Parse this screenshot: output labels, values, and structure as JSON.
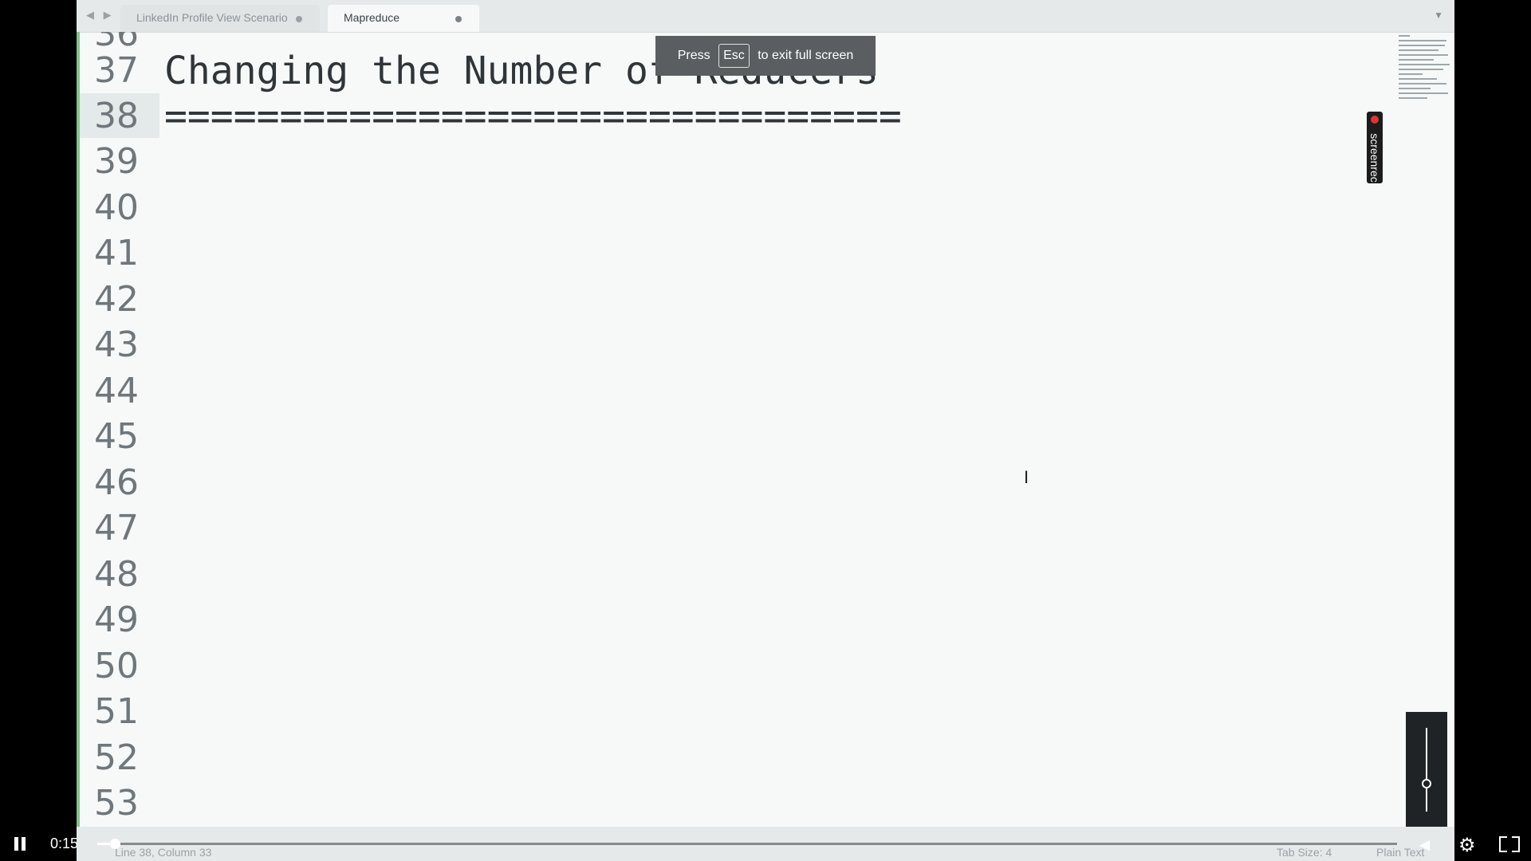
{
  "tabs": [
    {
      "label": "LinkedIn Profile View Scenario",
      "active": false
    },
    {
      "label": "Mapreduce",
      "active": true
    }
  ],
  "tab_nav_arrows": "◀ ▶",
  "tab_menu_icon": "▼",
  "editor": {
    "lines": [
      {
        "num": "37",
        "text": "Changing the Number of Reducers"
      },
      {
        "num": "38",
        "text": "================================"
      },
      {
        "num": "39",
        "text": ""
      },
      {
        "num": "40",
        "text": ""
      },
      {
        "num": "41",
        "text": ""
      },
      {
        "num": "42",
        "text": ""
      },
      {
        "num": "43",
        "text": ""
      },
      {
        "num": "44",
        "text": ""
      },
      {
        "num": "45",
        "text": ""
      },
      {
        "num": "46",
        "text": ""
      },
      {
        "num": "47",
        "text": ""
      },
      {
        "num": "48",
        "text": ""
      },
      {
        "num": "49",
        "text": ""
      },
      {
        "num": "50",
        "text": ""
      },
      {
        "num": "51",
        "text": ""
      },
      {
        "num": "52",
        "text": ""
      },
      {
        "num": "53",
        "text": ""
      }
    ],
    "current_line": "38"
  },
  "status_bar": {
    "position": "Line 38, Column 33",
    "tab_size": "Tab Size: 4",
    "syntax": "Plain Text"
  },
  "fullscreen_toast": {
    "prefix": "Press",
    "key": "Esc",
    "suffix": "to exit full screen"
  },
  "screenrec_badge": "screenrec",
  "player": {
    "time": "0:15",
    "progress_fraction": 0.01,
    "volume_fraction": 0.35,
    "colors": {
      "accent": "#ffffff",
      "track": "#8a8a8a"
    }
  }
}
